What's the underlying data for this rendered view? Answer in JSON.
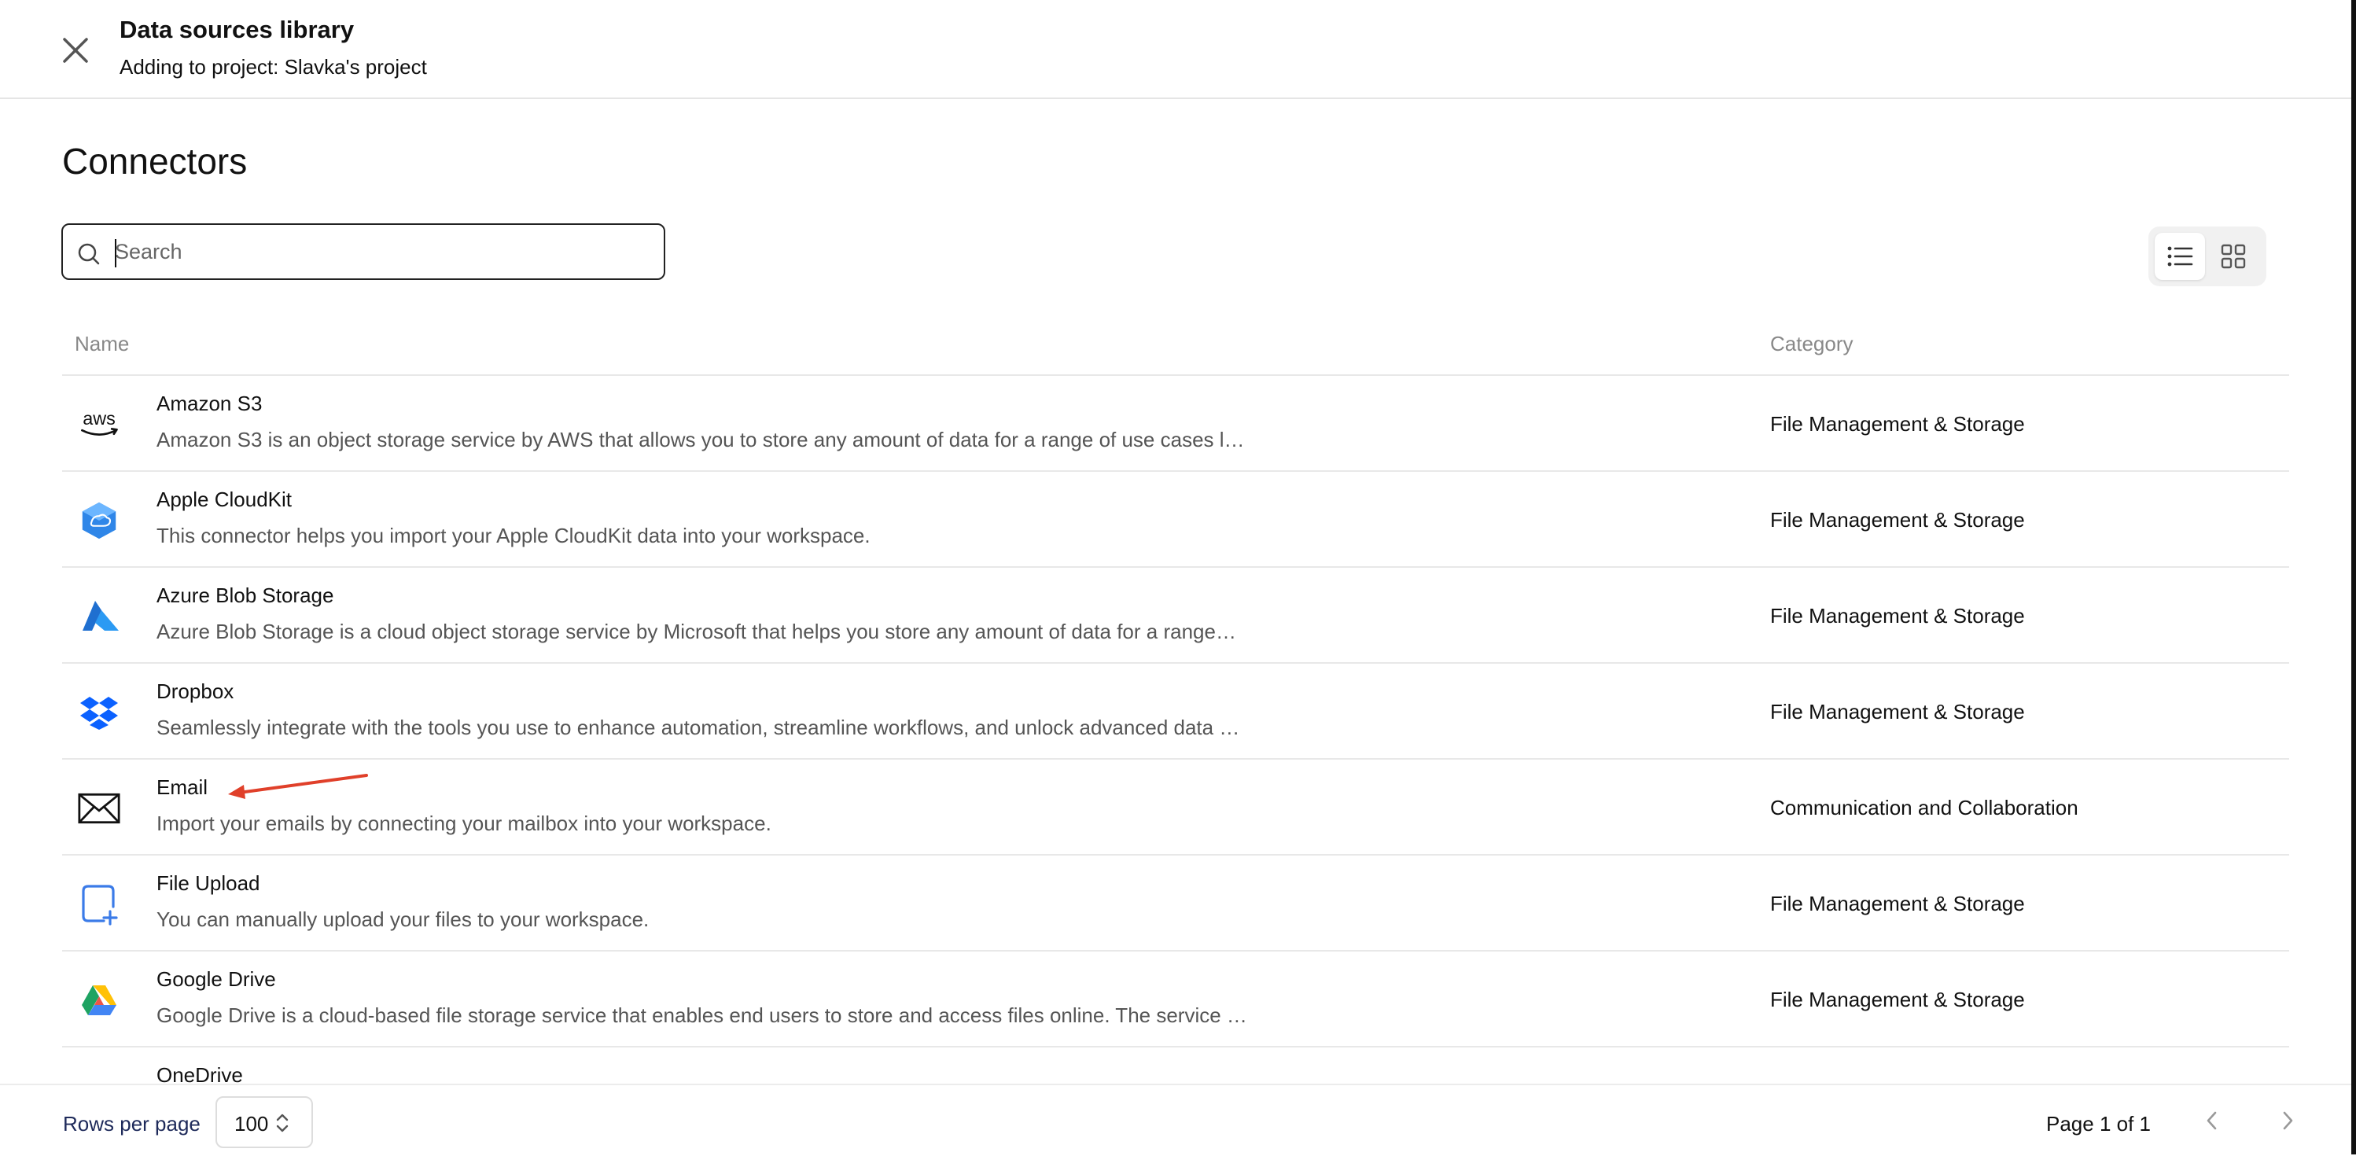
{
  "header": {
    "title": "Data sources library",
    "subtitle": "Adding to project: Slavka's project",
    "close_icon": "close-icon"
  },
  "main": {
    "title": "Connectors",
    "search": {
      "placeholder": "Search",
      "value": ""
    },
    "view_toggle": {
      "active": "list",
      "icons": [
        "list-view-icon",
        "grid-view-icon"
      ]
    },
    "table": {
      "columns": [
        "Name",
        "Category"
      ],
      "rows": [
        {
          "name": "Amazon S3",
          "description": "Amazon S3 is an object storage service by AWS that allows you to store any amount of data for a range of use cases l…",
          "category": "File Management & Storage",
          "icon": "aws-logo-icon"
        },
        {
          "name": "Apple CloudKit",
          "description": "This connector helps you import your Apple CloudKit data into your workspace.",
          "category": "File Management & Storage",
          "icon": "cloudkit-logo-icon"
        },
        {
          "name": "Azure Blob Storage",
          "description": "Azure Blob Storage is a cloud object storage service by Microsoft that helps you store any amount of data for a range…",
          "category": "File Management & Storage",
          "icon": "azure-logo-icon"
        },
        {
          "name": "Dropbox",
          "description": "Seamlessly integrate with the tools you use to enhance automation, streamline workflows, and unlock advanced data …",
          "category": "File Management & Storage",
          "icon": "dropbox-logo-icon"
        },
        {
          "name": "Email",
          "description": "Import your emails by connecting your mailbox into your workspace.",
          "category": "Communication and Collaboration",
          "icon": "envelope-icon"
        },
        {
          "name": "File Upload",
          "description": "You can manually upload your files to your workspace.",
          "category": "File Management & Storage",
          "icon": "file-upload-icon"
        },
        {
          "name": "Google Drive",
          "description": "Google Drive is a cloud-based file storage service that enables end users to store and access files online. The service …",
          "category": "File Management & Storage",
          "icon": "google-drive-logo-icon"
        },
        {
          "name": "OneDrive",
          "description": "",
          "category": "",
          "icon": "onedrive-logo-icon"
        }
      ]
    }
  },
  "annotation": {
    "arrow_color": "#e0402a"
  },
  "footer": {
    "rows_per_page_label": "Rows per page",
    "rows_per_page_value": "100",
    "page_text": "Page 1 of 1"
  },
  "colors": {
    "rows_label": "#1e2a5a",
    "border": "#e8e8e8",
    "muted_text": "#555555"
  }
}
